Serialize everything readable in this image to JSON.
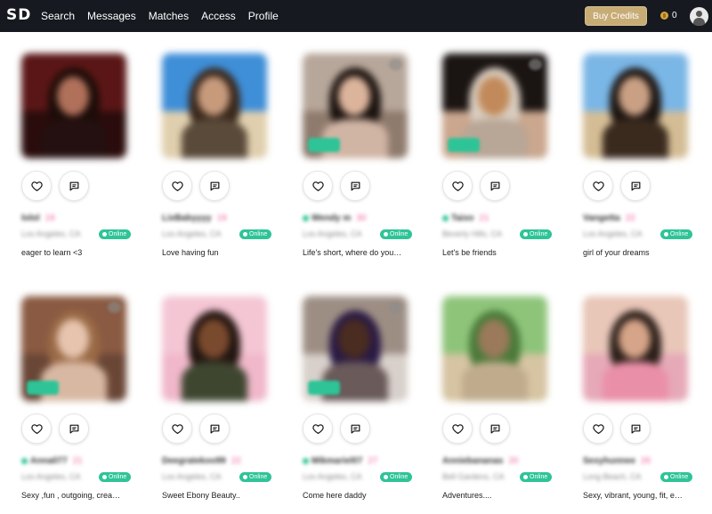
{
  "header": {
    "logo": "SD",
    "nav": [
      {
        "label": "Search"
      },
      {
        "label": "Messages"
      },
      {
        "label": "Matches"
      },
      {
        "label": "Access"
      },
      {
        "label": "Profile"
      }
    ],
    "buy_credits_label": "Buy Credits",
    "credits_count": "0",
    "icons": {
      "coin": "coin-icon",
      "user": "user-avatar-icon"
    }
  },
  "card_icons": {
    "like": "heart-icon",
    "message": "message-icon"
  },
  "colors": {
    "accent_gold": "#c8ac76",
    "online_green": "#2ec497",
    "age_pink": "#ee5f9c",
    "topbar": "#16191f"
  },
  "profiles": [
    {
      "name": "lolol",
      "age": "19",
      "location": "Los Angeles, CA",
      "status": "Online",
      "tagline": "eager to learn <3",
      "verified": false
    },
    {
      "name": "LixBabyyyy",
      "age": "19",
      "location": "Los Angeles, CA",
      "status": "Online",
      "tagline": "Love having fun",
      "verified": false
    },
    {
      "name": "Wendy m",
      "age": "30",
      "location": "Los Angeles, CA",
      "status": "Online",
      "tagline": "Life's short, where do you…",
      "verified": true
    },
    {
      "name": "Taixo",
      "age": "21",
      "location": "Beverly Hills, CA",
      "status": "Online",
      "tagline": "Let's be friends",
      "verified": true
    },
    {
      "name": "Vangetta",
      "age": "22",
      "location": "Los Angeles, CA",
      "status": "Online",
      "tagline": "girl of your dreams",
      "verified": false
    },
    {
      "name": "Anna077",
      "age": "21",
      "location": "Los Angeles, CA",
      "status": "Online",
      "tagline": "Sexy ,fun , outgoing, crea…",
      "verified": true
    },
    {
      "name": "Deegratekoo99",
      "age": "22",
      "location": "Los Angeles, CA",
      "status": "Online",
      "tagline": "Sweet Ebony Beauty..",
      "verified": false
    },
    {
      "name": "Mikmariel07",
      "age": "27",
      "location": "Los Angeles, CA",
      "status": "Online",
      "tagline": "Come here daddy",
      "verified": true
    },
    {
      "name": "Anniebananas",
      "age": "20",
      "location": "Bell Gardens, CA",
      "status": "Online",
      "tagline": "Adventures....",
      "verified": false
    },
    {
      "name": "Sexyhunnee",
      "age": "26",
      "location": "Long Beach, CA",
      "status": "Online",
      "tagline": "Sexy, vibrant, young, fit, e…",
      "verified": false
    }
  ]
}
